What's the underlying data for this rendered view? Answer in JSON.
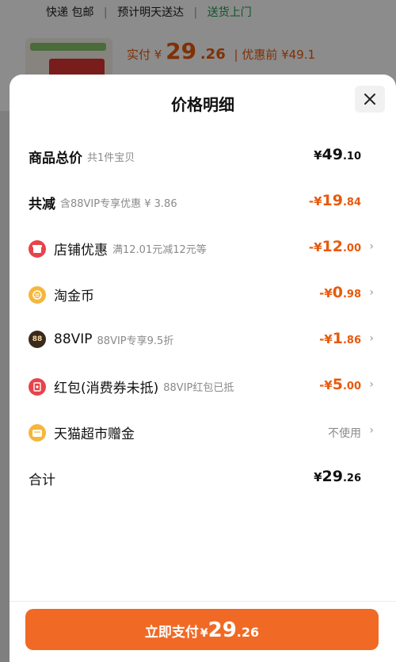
{
  "background": {
    "shipping": {
      "carrier": "快递",
      "shipping_fee": "包邮",
      "estimate": "预计明天送达",
      "delivery_service": "送货上门"
    },
    "price": {
      "paid_prefix": "实付 ¥",
      "paid_int": "29",
      "paid_dec": ".26",
      "pre_discount": "| 优惠前 ¥49.1"
    }
  },
  "sheet": {
    "title": "价格明细",
    "close_label": "×",
    "rows": [
      {
        "label": "商品总价",
        "sub": "共1件宝贝",
        "value_cur": "¥",
        "value_main": "49",
        "value_dec": ".10"
      },
      {
        "label": "共减",
        "sub": "含88VIP专享优惠 ¥ 3.86",
        "value_cur": "-¥",
        "value_main": "19",
        "value_dec": ".84"
      },
      {
        "label": "店铺优惠",
        "sub": "满12.01元减12元等",
        "value_cur": "-¥",
        "value_main": "12",
        "value_dec": ".00",
        "icon": "shop-icon"
      },
      {
        "label": "淘金币",
        "sub": "",
        "value_cur": "-¥",
        "value_main": "0",
        "value_dec": ".98",
        "icon": "coin-icon"
      },
      {
        "label": "88VIP",
        "sub": "88VIP专享9.5折",
        "value_cur": "-¥",
        "value_main": "1",
        "value_dec": ".86",
        "icon": "vip88-icon"
      },
      {
        "label": "红包(消费券未抵)",
        "sub": "88VIP红包已抵",
        "value_cur": "-¥",
        "value_main": "5",
        "value_dec": ".00",
        "icon": "red-envelope-icon"
      },
      {
        "label": "天猫超市赠金",
        "sub": "",
        "value_text": "不使用",
        "icon": "gift-fund-icon"
      },
      {
        "label": "合计",
        "sub": "",
        "value_cur": "¥",
        "value_main": "29",
        "value_dec": ".26"
      }
    ],
    "pay_button": {
      "prefix": "立即支付",
      "cur": "¥",
      "int": "29",
      "dec": ".26"
    }
  },
  "colors": {
    "accent_orange": "#f06a25",
    "value_orange": "#e8590c",
    "green": "#1a9c4a"
  }
}
